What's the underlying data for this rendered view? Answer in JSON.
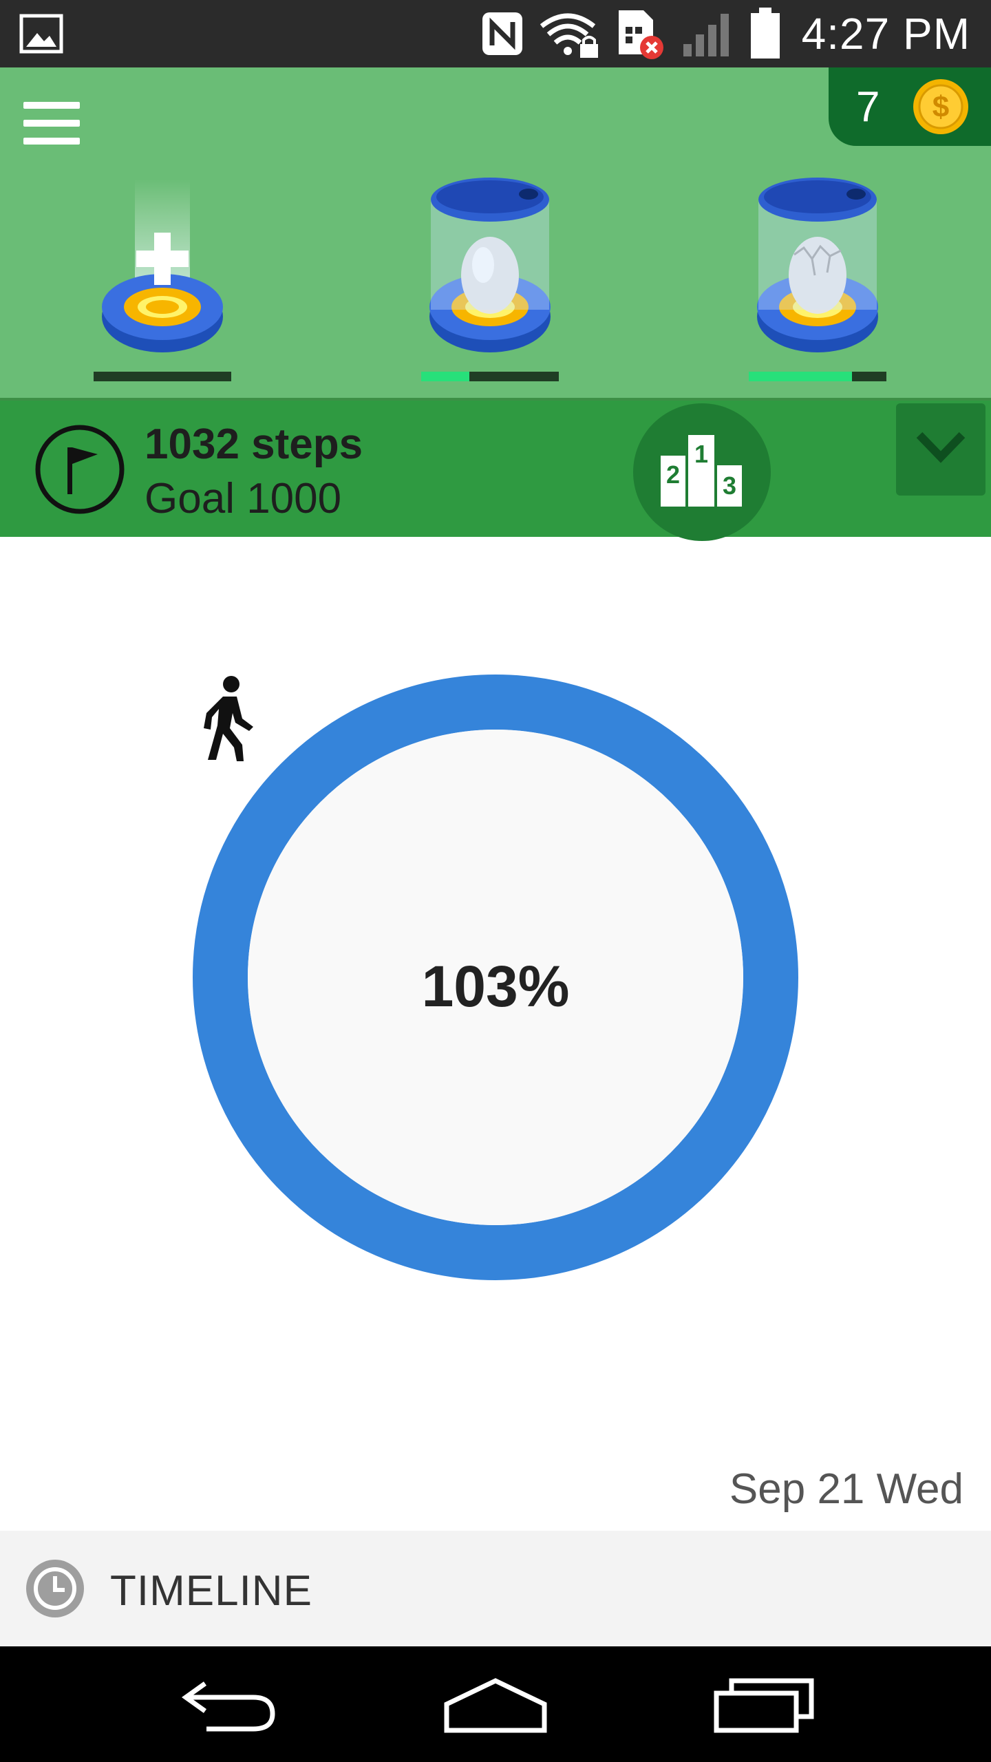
{
  "status_bar": {
    "time": "4:27 PM",
    "icons": [
      "gallery-icon",
      "nfc-icon",
      "wifi-lock-icon",
      "sim-error-icon",
      "signal-icon",
      "battery-icon"
    ]
  },
  "header": {
    "menu_icon": "hamburger-menu-icon",
    "coins": "7",
    "coin_icon": "gold-coin-icon",
    "slots": [
      {
        "name": "add-incubator-slot",
        "icon": "plus-pad-icon",
        "progress": 0
      },
      {
        "name": "egg-incubator-slot-1",
        "icon": "egg-incubator-icon",
        "progress": 0.35
      },
      {
        "name": "egg-incubator-slot-2",
        "icon": "cracked-egg-incubator-icon",
        "progress": 0.75
      }
    ]
  },
  "steps": {
    "count_label": "1032 steps",
    "goal_label": "Goal 1000",
    "flag_icon": "goal-flag-icon",
    "leaderboard_icon": "leaderboard-podium-icon",
    "expand_icon": "chevron-down-icon"
  },
  "progress": {
    "percent_label": "103%",
    "fraction": 1.03,
    "icon": "walking-person-icon",
    "ring_color": "#3584da"
  },
  "date_label": "Sep 21 Wed",
  "timeline": {
    "label": "TIMELINE",
    "icon": "clock-icon"
  },
  "nav_bar": {
    "buttons": [
      "back-icon",
      "home-icon",
      "recent-apps-icon"
    ]
  },
  "colors": {
    "header_green": "#6abd76",
    "steps_green": "#2f9a41",
    "dark_green": "#0f6b2b",
    "progress_fill": "#27e07a"
  }
}
